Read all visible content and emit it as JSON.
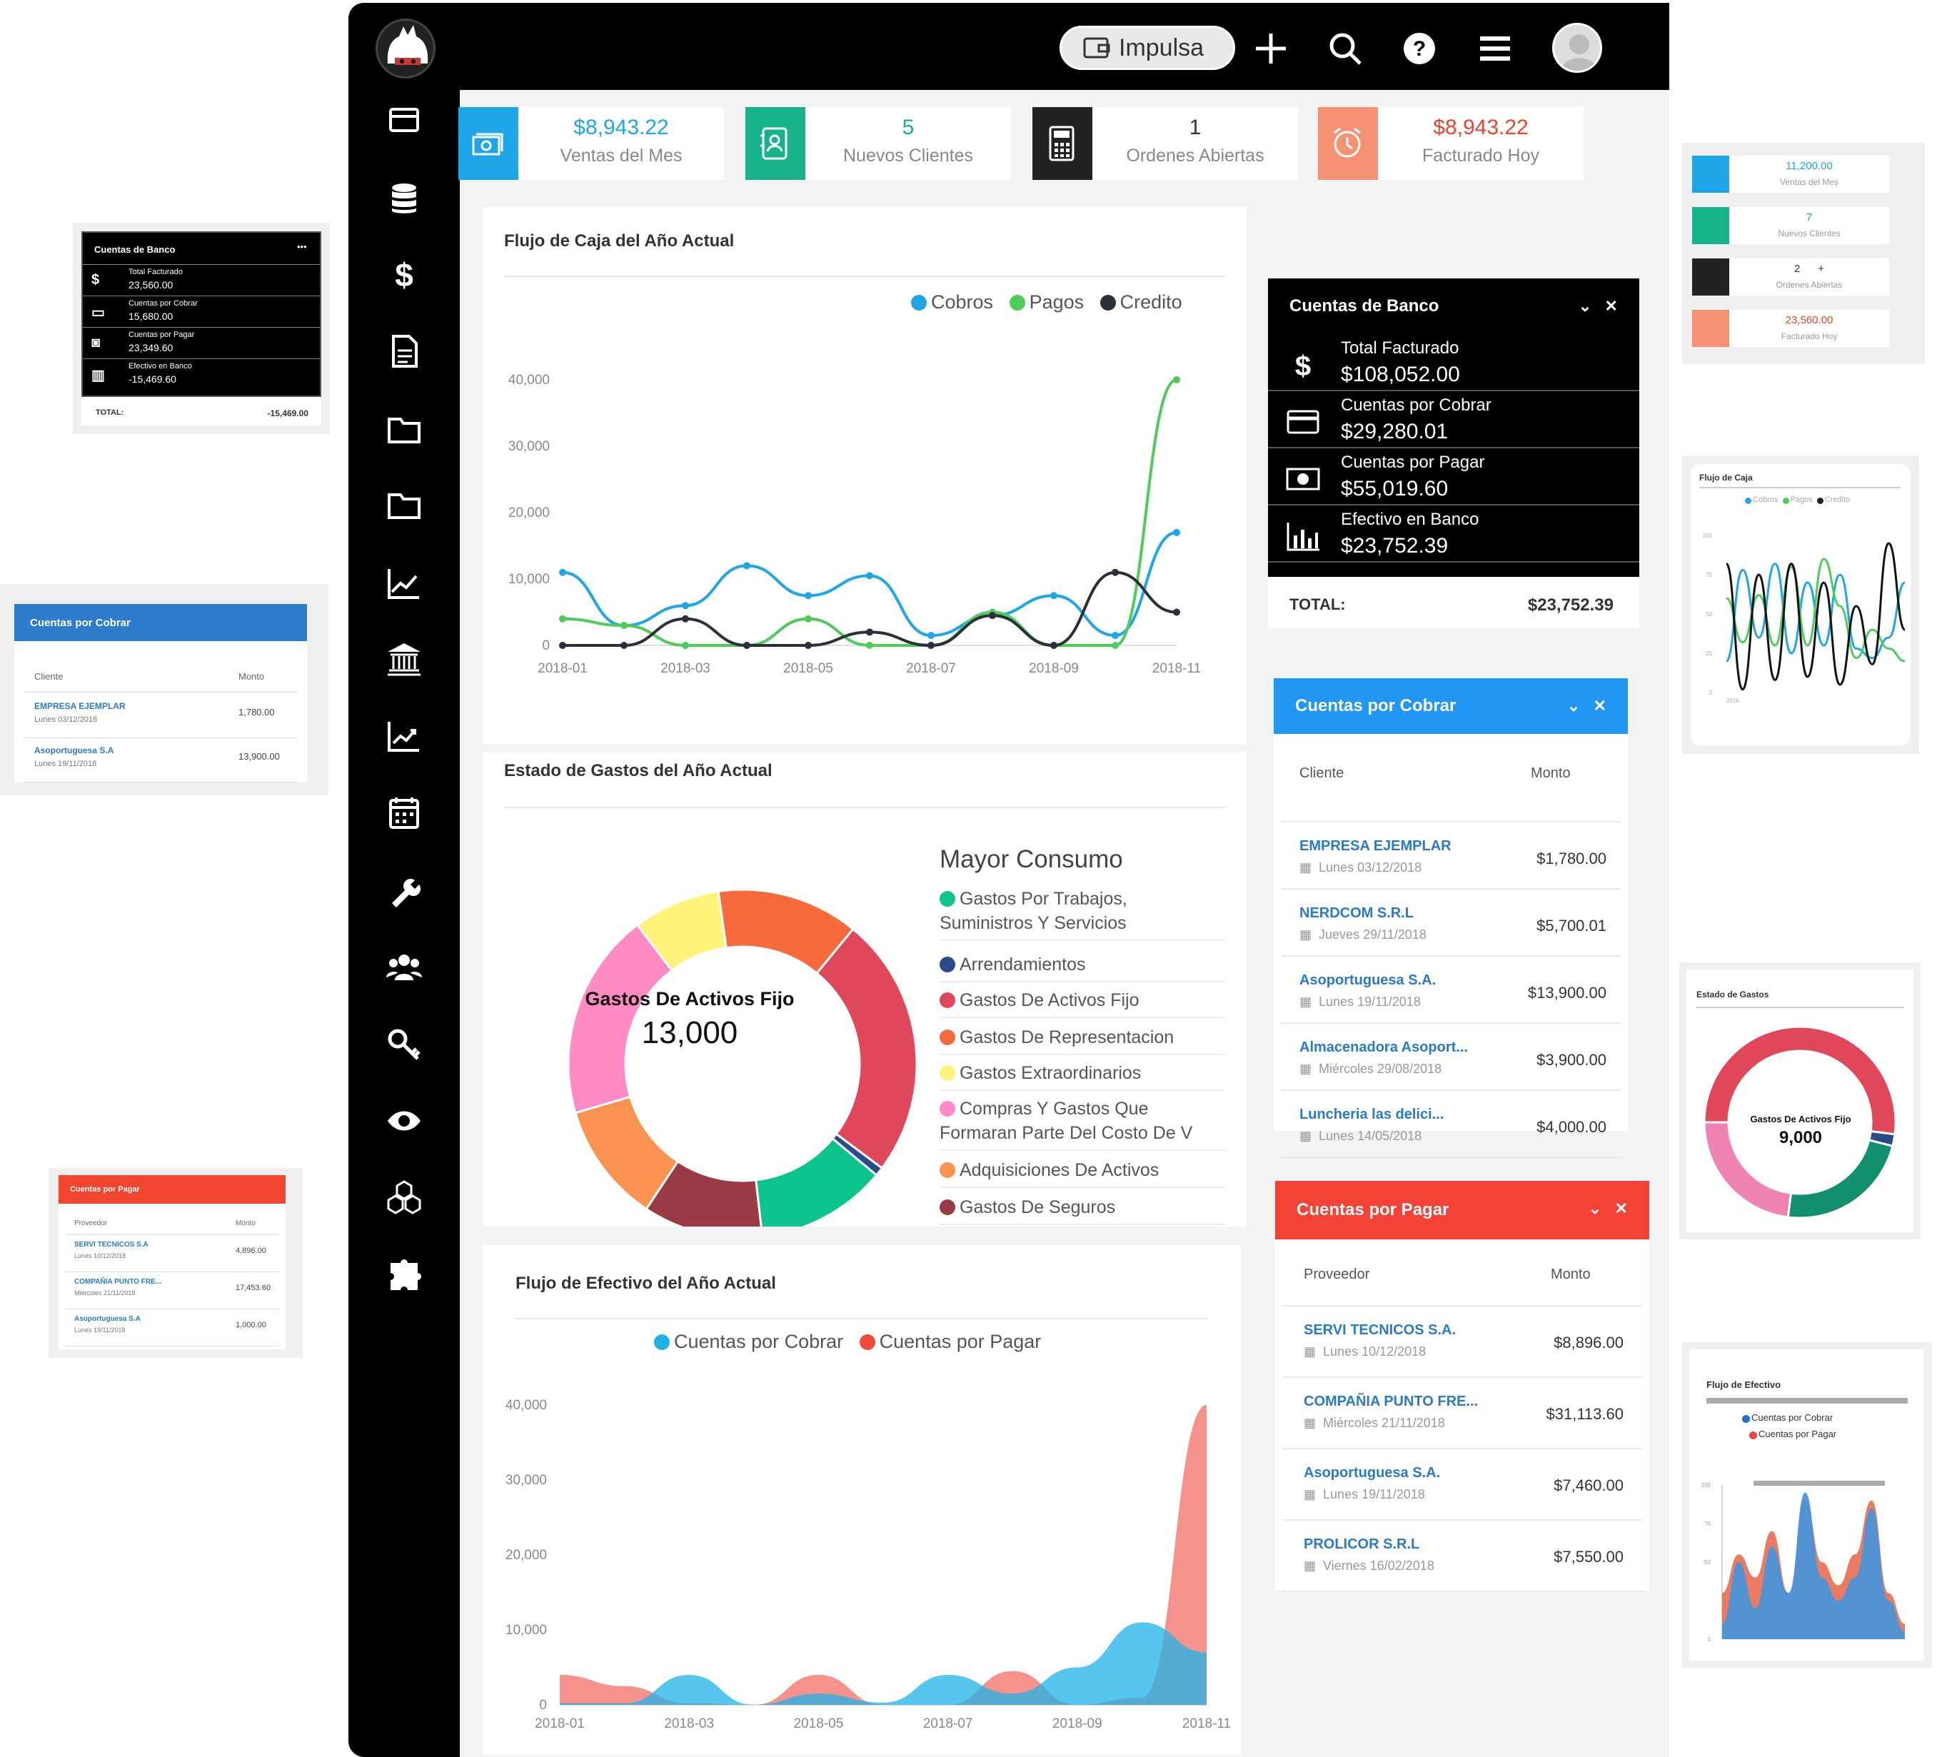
{
  "topbar": {
    "brand_button": "Impulsa",
    "icons": [
      "plus-icon",
      "search-icon",
      "help-icon",
      "menu-icon",
      "avatar"
    ]
  },
  "sidebar": {
    "items": [
      "card-icon",
      "database-icon",
      "dollar-icon",
      "document-icon",
      "folder-icon",
      "folder-icon",
      "line-chart-icon",
      "bank-icon",
      "trend-chart-icon",
      "calendar-icon",
      "wrench-icon",
      "users-icon",
      "key-icon",
      "eye-icon",
      "cubes-icon",
      "puzzle-icon"
    ]
  },
  "stats": [
    {
      "value": "$8,943.22",
      "label": "Ventas del Mes",
      "color": "#1fa6e8",
      "value_color": "#1fa6e8",
      "icon": "money-icon"
    },
    {
      "value": "5",
      "label": "Nuevos Clientes",
      "color": "#16b38a",
      "value_color": "#16b38a",
      "icon": "contact-book-icon"
    },
    {
      "value": "1",
      "label": "Ordenes Abiertas",
      "color": "#222222",
      "value_color": "#333333",
      "icon": "calculator-icon"
    },
    {
      "value": "$8,943.22",
      "label": "Facturado Hoy",
      "color": "#f59274",
      "value_color": "#e8442f",
      "icon": "alarm-clock-icon"
    }
  ],
  "cashflow": {
    "title": "Flujo de Caja del Año Actual",
    "chart_data": {
      "type": "line",
      "x": [
        "2018-01",
        "2018-02",
        "2018-03",
        "2018-04",
        "2018-05",
        "2018-06",
        "2018-07",
        "2018-08",
        "2018-09",
        "2018-10",
        "2018-11"
      ],
      "x_ticks": [
        "2018-01",
        "2018-03",
        "2018-05",
        "2018-07",
        "2018-09",
        "2018-11"
      ],
      "y_ticks": [
        "40,000",
        "30,000",
        "20,000",
        "10,000",
        "0"
      ],
      "ylim": [
        0,
        40000
      ],
      "series": [
        {
          "name": "Cobros",
          "color": "#1fa6e8",
          "values": [
            11000,
            3000,
            6000,
            12000,
            7500,
            10500,
            1500,
            4500,
            7500,
            1500,
            17000
          ]
        },
        {
          "name": "Pagos",
          "color": "#4dcc5a",
          "values": [
            4000,
            3000,
            0,
            0,
            4000,
            0,
            0,
            5000,
            0,
            0,
            40000
          ]
        },
        {
          "name": "Credito",
          "color": "#2b2f3a",
          "values": [
            0,
            0,
            4000,
            0,
            0,
            2000,
            0,
            4500,
            0,
            11000,
            5000
          ]
        }
      ]
    }
  },
  "expenses": {
    "title": "Estado de Gastos del Año Actual",
    "center_label": "Gastos De Activos Fijo",
    "center_value": "13,000",
    "legend_title": "Mayor Consumo",
    "legend": [
      {
        "label": "Gastos Por Trabajos, Suministros Y Servicios",
        "color": "#0dc48f"
      },
      {
        "label": "Arrendamientos",
        "color": "#2b4a8c"
      },
      {
        "label": "Gastos De Activos Fijo",
        "color": "#e0475a"
      },
      {
        "label": "Gastos De Representacion",
        "color": "#f76a3c"
      },
      {
        "label": "Gastos Extraordinarios",
        "color": "#fff37a"
      },
      {
        "label": "Compras Y Gastos Que Formaran Parte Del Costo De V",
        "color": "#ff8ac4"
      },
      {
        "label": "Adquisiciones De Activos",
        "color": "#fa9350"
      },
      {
        "label": "Gastos De Seguros",
        "color": "#993a44"
      }
    ],
    "chart_data": {
      "type": "pie",
      "categories": [
        "Gastos De Representacion",
        "Gastos De Activos Fijo",
        "Arrendamientos",
        "Gastos Por Trabajos, Suministros Y Servicios",
        "Gastos De Seguros",
        "Adquisiciones De Activos",
        "Compras Y Gastos Que Formaran Parte Del Costo De V",
        "Gastos Extraordinarios"
      ],
      "values": [
        13,
        24,
        0.8,
        12,
        11,
        11,
        19,
        8
      ],
      "colors": [
        "#f76a3c",
        "#e0475a",
        "#2b4a8c",
        "#0dc48f",
        "#993a44",
        "#fa9350",
        "#ff8ac4",
        "#fff37a"
      ]
    }
  },
  "effective": {
    "title": "Flujo de Efectivo del Año Actual",
    "chart_data": {
      "type": "area",
      "x": [
        "2018-01",
        "2018-02",
        "2018-03",
        "2018-04",
        "2018-05",
        "2018-06",
        "2018-07",
        "2018-08",
        "2018-09",
        "2018-10",
        "2018-11"
      ],
      "x_ticks": [
        "2018-01",
        "2018-03",
        "2018-05",
        "2018-07",
        "2018-09",
        "2018-11"
      ],
      "y_ticks": [
        "40,000",
        "30,000",
        "20,000",
        "10,000",
        "0"
      ],
      "ylim": [
        0,
        40000
      ],
      "series": [
        {
          "name": "Cuentas por Cobrar",
          "color": "#1fb3e8",
          "values": [
            200,
            200,
            4000,
            0,
            1500,
            300,
            4000,
            1500,
            5000,
            11000,
            7000
          ]
        },
        {
          "name": "Cuentas por Pagar",
          "color": "#ef4a3d",
          "values": [
            4000,
            2500,
            200,
            0,
            4000,
            0,
            0,
            4500,
            0,
            1000,
            40000
          ]
        }
      ]
    }
  },
  "bank": {
    "title": "Cuentas de Banco",
    "rows": [
      {
        "label": "Total Facturado",
        "value": "$108,052.00",
        "icon": "dollar-icon"
      },
      {
        "label": "Cuentas por Cobrar",
        "value": "$29,280.01",
        "icon": "credit-card-icon"
      },
      {
        "label": "Cuentas por Pagar",
        "value": "$55,019.60",
        "icon": "cash-icon"
      },
      {
        "label": "Efectivo en Banco",
        "value": "$23,752.39",
        "icon": "bar-chart-icon"
      }
    ],
    "total_label": "TOTAL:",
    "total_value": "$23,752.39"
  },
  "receivables": {
    "title": "Cuentas por Cobrar",
    "col_client": "Cliente",
    "col_amount": "Monto",
    "rows": [
      {
        "name": "EMPRESA EJEMPLAR",
        "date": "Lunes 03/12/2018",
        "amount": "$1,780.00"
      },
      {
        "name": "NERDCOM S.R.L",
        "date": "Jueves 29/11/2018",
        "amount": "$5,700.01"
      },
      {
        "name": "Asoportuguesa S.A.",
        "date": "Lunes 19/11/2018",
        "amount": "$13,900.00"
      },
      {
        "name": "Almacenadora Asoport...",
        "date": "Miércoles 29/08/2018",
        "amount": "$3,900.00"
      },
      {
        "name": "Luncheria las delici...",
        "date": "Lunes 14/05/2018",
        "amount": "$4,000.00"
      }
    ]
  },
  "payables": {
    "title": "Cuentas por Pagar",
    "col_provider": "Proveedor",
    "col_amount": "Monto",
    "rows": [
      {
        "name": "SERVI TECNICOS S.A.",
        "date": "Lunes 10/12/2018",
        "amount": "$8,896.00"
      },
      {
        "name": "COMPAÑIA PUNTO FRE...",
        "date": "Miércoles 21/11/2018",
        "amount": "$31,113.60"
      },
      {
        "name": "Asoportuguesa S.A.",
        "date": "Lunes 19/11/2018",
        "amount": "$7,460.00"
      },
      {
        "name": "PROLICOR S.R.L",
        "date": "Viernes 16/02/2018",
        "amount": "$7,550.00"
      }
    ]
  },
  "mini_bank": {
    "title": "Cuentas de Banco",
    "menu": "•••",
    "rows": [
      {
        "label": "Total Facturado",
        "value": "23,560.00"
      },
      {
        "label": "Cuentas por Cobrar",
        "value": "15,680.00"
      },
      {
        "label": "Cuentas por Pagar",
        "value": "23,349.60"
      },
      {
        "label": "Efectivo en Banco",
        "value": "-15,469.60"
      }
    ],
    "total_label": "TOTAL:",
    "total_value": "-15,469.00"
  },
  "mini_receivables": {
    "title": "Cuentas por Cobrar",
    "col_client": "Cliente",
    "col_amount": "Monto",
    "rows": [
      {
        "name": "EMPRESA EJEMPLAR",
        "date": "Lunes 03/12/2018",
        "amount": "1,780.00"
      },
      {
        "name": "Asoportuguesa S.A",
        "date": "Lunes 19/11/2018",
        "amount": "13,900.00"
      }
    ]
  },
  "mini_payables": {
    "title": "Cuentas por Pagar",
    "col_provider": "Proveedor",
    "col_amount": "Monto",
    "rows": [
      {
        "name": "SERVI TECNICOS S.A",
        "date": "Lunes 10/12/2018",
        "amount": "4,896.00"
      },
      {
        "name": "COMPAÑIA PUNTO FRE...",
        "date": "Miércoles 21/11/2018",
        "amount": "17,453.60"
      },
      {
        "name": "Asoportuguesa S.A",
        "date": "Lunes 19/11/2018",
        "amount": "1,000.00"
      }
    ]
  },
  "mini_stats": [
    {
      "value": "11,200.00",
      "label": "Ventas del Mes",
      "color": "#1fa6e8",
      "value_color": "#1fa6e8"
    },
    {
      "value": "7",
      "label": "Nuevos Clientes",
      "color": "#16b38a",
      "value_color": "#16b38a"
    },
    {
      "value": "2",
      "label": "Ordenes Abiertas",
      "color": "#222222",
      "value_color": "#333333",
      "extra": "+"
    },
    {
      "value": "23,560.00",
      "label": "Facturado Hoy",
      "color": "#f59274",
      "value_color": "#e8442f"
    }
  ],
  "mini_cashflow": {
    "title": "Flujo de Caja",
    "legend": [
      {
        "name": "Cobros",
        "color": "#1fa6e8"
      },
      {
        "name": "Pagos",
        "color": "#4dcc5a"
      },
      {
        "name": "Credito",
        "color": "#222"
      }
    ],
    "chart_data": {
      "type": "line",
      "y_ticks": [
        "100",
        "75",
        "50",
        "25",
        "0"
      ],
      "x_ticks": [
        "2016"
      ],
      "ylim": [
        0,
        100
      ],
      "series": [
        {
          "name": "Cobros",
          "color": "#1fa6e8",
          "values": [
            20,
            78,
            35,
            82,
            25,
            70,
            30,
            75,
            28,
            22,
            35,
            70
          ]
        },
        {
          "name": "Pagos",
          "color": "#4dcc5a",
          "values": [
            60,
            32,
            62,
            30,
            80,
            30,
            85,
            55,
            22,
            40,
            28,
            20
          ]
        },
        {
          "name": "Credito",
          "color": "#111",
          "values": [
            82,
            2,
            75,
            8,
            82,
            10,
            70,
            5,
            55,
            18,
            95,
            40
          ]
        }
      ]
    }
  },
  "mini_expenses": {
    "title": "Estado de Gastos",
    "center_label": "Gastos De Activos Fijo",
    "center_value": "9,000",
    "chart_data": {
      "type": "pie",
      "categories": [
        "Gastos De Activos Fijo",
        "Arrendamientos",
        "Gastos Por Trabajos",
        "Compras Y Gastos"
      ],
      "values": [
        52,
        2,
        23,
        23
      ],
      "colors": [
        "#e0475a",
        "#2b4a8c",
        "#128f6c",
        "#ef83b4"
      ]
    }
  },
  "mini_effective": {
    "title": "Flujo de Efectivo",
    "legend": [
      {
        "name": "Cuentas por Cobrar",
        "color": "#1f74c9"
      },
      {
        "name": "Cuentas por Pagar",
        "color": "#e84a3d"
      }
    ],
    "chart_data": {
      "type": "area",
      "y_ticks": [
        "100",
        "75",
        "50",
        "0"
      ],
      "ylim": [
        0,
        100
      ],
      "series": [
        {
          "name": "Cuentas por Pagar",
          "color": "#e8745a",
          "values": [
            30,
            55,
            40,
            70,
            30,
            90,
            50,
            35,
            55,
            90,
            30,
            10
          ]
        },
        {
          "name": "Cuentas por Cobrar",
          "color": "#4a94d6",
          "values": [
            10,
            50,
            20,
            60,
            30,
            95,
            40,
            25,
            40,
            85,
            25,
            5
          ]
        }
      ]
    }
  }
}
